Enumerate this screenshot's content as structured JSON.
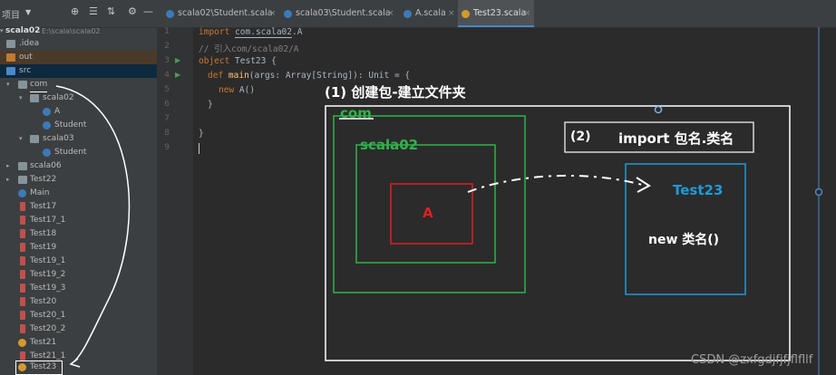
{
  "project_panel": {
    "title": "项目",
    "toolbar_icons": [
      "target-icon",
      "expand-all-icon",
      "collapse-all-icon",
      "gear-icon",
      "hide-icon"
    ],
    "root": {
      "name": "scala02",
      "path": "E:\\scala\\scala02"
    },
    "items": [
      {
        "label": ".idea"
      },
      {
        "label": "out"
      },
      {
        "label": "src"
      },
      {
        "label": "com"
      },
      {
        "label": "scala02"
      },
      {
        "label": "A"
      },
      {
        "label": "Student"
      },
      {
        "label": "scala03"
      },
      {
        "label": "Student"
      },
      {
        "label": "scala06"
      },
      {
        "label": "Test22"
      },
      {
        "label": "Main"
      },
      {
        "label": "Test17"
      },
      {
        "label": "Test17_1"
      },
      {
        "label": "Test18"
      },
      {
        "label": "Test19"
      },
      {
        "label": "Test19_1"
      },
      {
        "label": "Test19_2"
      },
      {
        "label": "Test19_3"
      },
      {
        "label": "Test20"
      },
      {
        "label": "Test20_1"
      },
      {
        "label": "Test20_2"
      },
      {
        "label": "Test21"
      },
      {
        "label": "Test21_1"
      },
      {
        "label": "Test23"
      }
    ]
  },
  "editor_tabs": [
    {
      "label": "scala02\\Student.scala"
    },
    {
      "label": "scala03\\Student.scala"
    },
    {
      "label": "A.scala"
    },
    {
      "label": "Test23.scala"
    }
  ],
  "editor": {
    "line_numbers": [
      "1",
      "2",
      "3",
      "4",
      "5",
      "6",
      "7",
      "8",
      "9"
    ],
    "lines": {
      "l1_kw": "import",
      "l1_pkg": "com.scala02",
      "l1_rest": ".A",
      "l2": "// 引入com/scala02/A",
      "l3_kw": "object",
      "l3_rest": " Test23 {",
      "l4_kw": "def",
      "l4_fn": "main",
      "l4_rest": "(args: Array[String]): Unit = {",
      "l5_kw": "new",
      "l5_rest": " A()",
      "l6": "}",
      "l8": "}"
    }
  },
  "annotation": {
    "step1": "(1) 创建包-建立文件夹",
    "com": "com",
    "scala02": "scala02",
    "class_a": "A",
    "step2_num": "(2)",
    "step2_text": "import 包名.类名",
    "test23": "Test23",
    "new_stmt": "new 类名()",
    "colors": {
      "green": "#2fb34a",
      "red": "#e02020",
      "blue": "#1d9bd8",
      "white": "#ffffff"
    }
  },
  "watermark": "CSDN @zxfgdjfjfjflfllf"
}
